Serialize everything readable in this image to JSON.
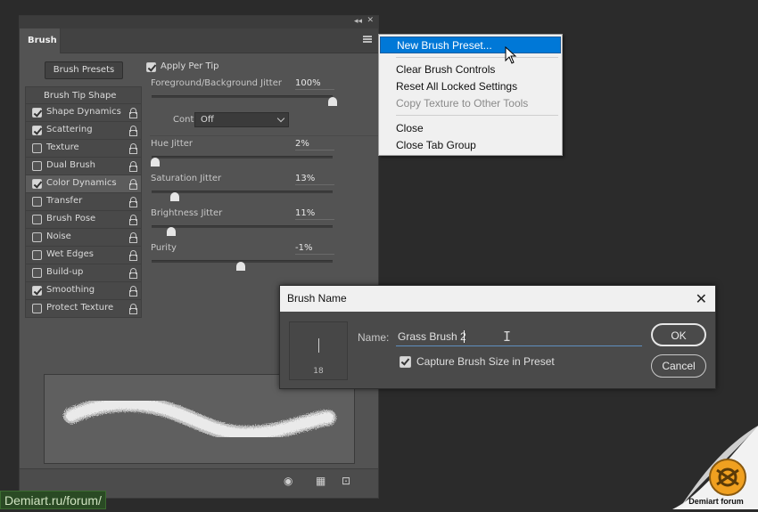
{
  "panel": {
    "tab_label": "Brush",
    "brush_presets_button": "Brush Presets",
    "apply_per_tip": {
      "label": "Apply Per Tip",
      "checked": true
    },
    "list_header": "Brush Tip Shape",
    "items": [
      {
        "label": "Shape Dynamics",
        "checked": true,
        "selected": false
      },
      {
        "label": "Scattering",
        "checked": true,
        "selected": false
      },
      {
        "label": "Texture",
        "checked": false,
        "selected": false
      },
      {
        "label": "Dual Brush",
        "checked": false,
        "selected": false
      },
      {
        "label": "Color Dynamics",
        "checked": true,
        "selected": true
      },
      {
        "label": "Transfer",
        "checked": false,
        "selected": false
      },
      {
        "label": "Brush Pose",
        "checked": false,
        "selected": false
      },
      {
        "label": "Noise",
        "checked": false,
        "selected": false
      },
      {
        "label": "Wet Edges",
        "checked": false,
        "selected": false
      },
      {
        "label": "Build-up",
        "checked": false,
        "selected": false
      },
      {
        "label": "Smoothing",
        "checked": true,
        "selected": false
      },
      {
        "label": "Protect Texture",
        "checked": false,
        "selected": false
      }
    ],
    "controls": {
      "fg_bg_jitter": {
        "label": "Foreground/Background Jitter",
        "value": "100%",
        "fraction": 1.0
      },
      "control": {
        "label": "Control:",
        "selected": "Off"
      },
      "hue_jitter": {
        "label": "Hue Jitter",
        "value": "2%",
        "fraction": 0.02
      },
      "saturation_jitter": {
        "label": "Saturation Jitter",
        "value": "13%",
        "fraction": 0.13
      },
      "brightness_jitter": {
        "label": "Brightness Jitter",
        "value": "11%",
        "fraction": 0.11
      },
      "purity": {
        "label": "Purity",
        "value": "-1%",
        "fraction": 0.495
      }
    }
  },
  "flyout_menu": {
    "items": [
      {
        "label": "New Brush Preset...",
        "state": "highlight"
      },
      {
        "label": "Clear Brush Controls",
        "state": "normal"
      },
      {
        "label": "Reset All Locked Settings",
        "state": "normal"
      },
      {
        "label": "Copy Texture to Other Tools",
        "state": "disabled"
      },
      {
        "label": "Close",
        "state": "normal"
      },
      {
        "label": "Close Tab Group",
        "state": "normal"
      }
    ]
  },
  "dialog": {
    "title": "Brush Name",
    "brush_size": "18",
    "name_label": "Name:",
    "name_value": "Grass Brush 2",
    "capture_size": {
      "label": "Capture Brush Size in Preset",
      "checked": true
    },
    "ok_label": "OK",
    "cancel_label": "Cancel"
  },
  "watermarks": {
    "left": "Demiart.ru/forum/",
    "right": "Demiart forum"
  },
  "colors": {
    "menu_highlight": "#0078d7",
    "panel_bg": "#535353",
    "app_bg": "#2b2b2b"
  }
}
